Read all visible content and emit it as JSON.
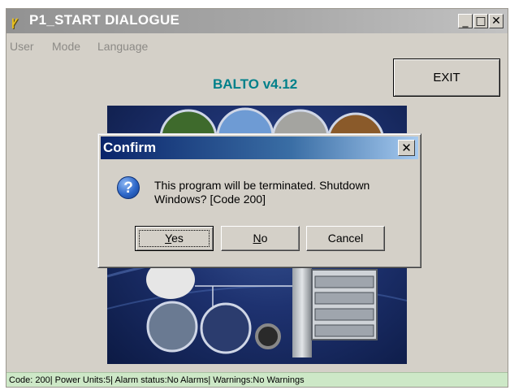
{
  "window": {
    "title": "P1_START DIALOGUE",
    "controls": {
      "minimize": "_",
      "maximize": "□",
      "close": "✕"
    }
  },
  "menu": [
    "User",
    "Mode",
    "Language"
  ],
  "app_version": "BALTO v4.12",
  "exit_button": "EXIT",
  "status_bar": "Code: 200| Power Units:5| Alarm status:No Alarms| Warnings:No Warnings",
  "dialog": {
    "title": "Confirm",
    "close": "✕",
    "icon": "question-icon",
    "message": "This program will be terminated. Shutdown Windows? [Code 200]",
    "buttons": {
      "yes": {
        "accel": "Y",
        "rest": "es"
      },
      "no": {
        "accel": "N",
        "rest": "o"
      },
      "cancel": "Cancel"
    }
  },
  "colors": {
    "version_text": "#00808a",
    "status_bar_bg": "#cde8c7",
    "dialog_title_start": "#0a246a",
    "dialog_title_end": "#a6caf0"
  }
}
